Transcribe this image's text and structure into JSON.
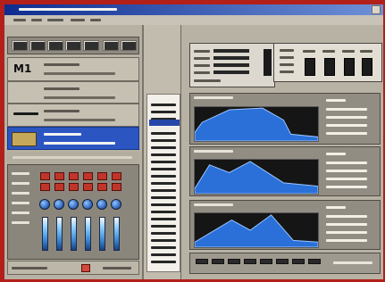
{
  "app": {
    "program_label": "M1"
  },
  "mixer": {
    "strip_count": 6
  },
  "envelope_curves": [
    {
      "points": [
        [
          0,
          0.25
        ],
        [
          0.06,
          0.55
        ],
        [
          0.28,
          0.92
        ],
        [
          0.55,
          0.97
        ],
        [
          0.72,
          0.62
        ],
        [
          0.78,
          0.2
        ],
        [
          1,
          0.12
        ]
      ]
    },
    {
      "points": [
        [
          0,
          0.15
        ],
        [
          0.12,
          0.85
        ],
        [
          0.28,
          0.62
        ],
        [
          0.45,
          0.95
        ],
        [
          0.72,
          0.32
        ],
        [
          1,
          0.22
        ]
      ]
    },
    {
      "points": [
        [
          0,
          0.15
        ],
        [
          0.3,
          0.8
        ],
        [
          0.45,
          0.5
        ],
        [
          0.62,
          0.95
        ],
        [
          0.8,
          0.2
        ],
        [
          1,
          0.15
        ]
      ]
    }
  ],
  "colors": {
    "frame": "#b3201a",
    "curve_fill": "#2a70d8",
    "highlight": "#2b56c2"
  }
}
